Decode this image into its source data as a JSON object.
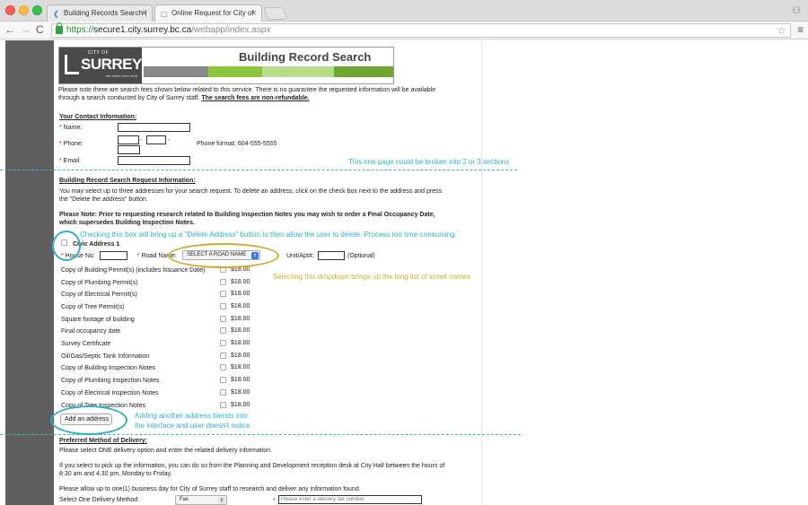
{
  "browser": {
    "tabs": [
      {
        "title": "Building Records Search |",
        "active": false
      },
      {
        "title": "Online Request for City of",
        "active": true
      }
    ],
    "url": {
      "scheme": "https://",
      "host": "secure1.city.surrey.bc.ca",
      "path": "/webapp/index.aspx"
    }
  },
  "banner": {
    "city_of": "CITY OF",
    "logo_text": "SURREY",
    "tagline": "the future lives here.",
    "title": "Building Record Search"
  },
  "intro": {
    "text": "Please note there are search fees shown below related to this service. There is no guarantee the requested information will be available through a search conducted by City of Surrey staff.",
    "bold": "The search fees are non-refundable."
  },
  "contact": {
    "heading": "Your Contact Information:",
    "name_label": "Name:",
    "phone_label": "Phone:",
    "phone_format": "Phone format: 604-555-5555",
    "email_label": "Email:"
  },
  "request": {
    "heading": "Building Record Search Request Information:",
    "instructions": "You may select up to three addresses for your search request. To delete an address, click on the check box next to the address and press the \"Delete the address\" button.",
    "note": "Please Note: Prior to requesting research related to Building Inspection Notes you may wish to order a Final Occupancy Date, which supersedes Building Inspection Notes.",
    "civic_label": "Civic Address 1",
    "house_label": "House No:",
    "road_label": "Road Name:",
    "road_select": "SELECT A ROAD NAME",
    "unit_label": "Unit/Apt#:",
    "optional": "(Optional)",
    "items": [
      {
        "label": "Copy of Building Permit(s) (includes Issuance Date)",
        "price": "$18.00"
      },
      {
        "label": "Copy of Plumbing Permit(s)",
        "price": "$18.00"
      },
      {
        "label": "Copy of Electrical Permit(s)",
        "price": "$18.00"
      },
      {
        "label": "Copy of Tree Permit(s)",
        "price": "$18.00"
      },
      {
        "label": "Square footage of building",
        "price": "$18.00"
      },
      {
        "label": "Final occupancy date",
        "price": "$18.00"
      },
      {
        "label": "Survey Certificate",
        "price": "$18.00"
      },
      {
        "label": "Oil/Gas/Septic Tank Information",
        "price": "$18.00"
      },
      {
        "label": "Copy of Building Inspection Notes",
        "price": "$18.00"
      },
      {
        "label": "Copy of Plumbing Inspection Notes",
        "price": "$18.00"
      },
      {
        "label": "Copy of Electrical Inspection Notes",
        "price": "$18.00"
      },
      {
        "label": "Copy of Tree Inspection Notes",
        "price": "$18.00"
      }
    ],
    "add_address": "Add an address"
  },
  "delivery": {
    "heading": "Preferred Method of Delivery:",
    "select_one": "Please select ONE delivery option and enter the related delivery information.",
    "pickup": "If you select to pick up the information, you can do so from the Planning and Development reception desk at City Hall between the hours of 8:30 am and 4:30 pm, Monday to Friday.",
    "allow": "Please allow up to one(1) business day for City of Surrey staff to research and deliver any information found.",
    "method_label": "Select One Delivery Method:",
    "method_value": "Fax",
    "fax_placeholder": "Please enter a delivery fax number."
  },
  "annotations": {
    "sections": "This one page could be broken into 2 or 3 sections",
    "checkbox": "Checking this box will bring up a \"Delete Address\" button to then allow the user to delete. Process too time-consuming.",
    "dropdown": "Selecting this dropdown brings up the long list of street names",
    "add_line1": "Adding another address blends into",
    "add_line2": "the interface and user doesn't notice"
  },
  "colors": {
    "teal": "#2fb0c3",
    "gold": "#d4a82a",
    "required": "#d00"
  }
}
